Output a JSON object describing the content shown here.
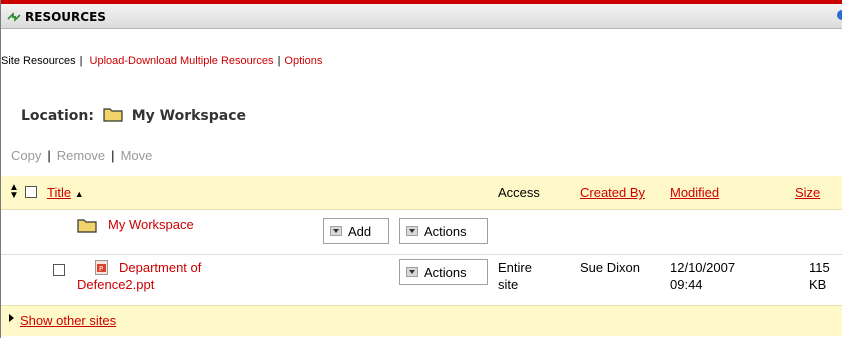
{
  "tool": {
    "title": "RESOURCES"
  },
  "nav": {
    "current": "Site Resources",
    "sep1": "|",
    "upload": "Upload-Download Multiple Resources",
    "sep2": "|",
    "options": "Options"
  },
  "location": {
    "label": "Location:",
    "name": "My Workspace"
  },
  "actions": {
    "copy": "Copy",
    "remove": "Remove",
    "move": "Move",
    "pipe": "|"
  },
  "table": {
    "headers": {
      "title": "Title",
      "access": "Access",
      "created_by": "Created By",
      "modified": "Modified",
      "size": "Size"
    },
    "folder_row": {
      "name": "My Workspace",
      "add_label": "Add",
      "actions_label": "Actions"
    },
    "file_row": {
      "name_line1": "Department of",
      "name_line2": "Defence2.ppt",
      "actions_label": "Actions",
      "access_line1": "Entire",
      "access_line2": "site",
      "created_by": "Sue Dixon",
      "modified_line1": "12/10/2007",
      "modified_line2": "09:44",
      "size_line1": "115",
      "size_line2": "KB"
    }
  },
  "footer": {
    "show_other_sites": "Show other sites"
  },
  "colors": {
    "link": "#cc0000",
    "header_bg": "#fff8c8",
    "top_border": "#cc0000"
  }
}
